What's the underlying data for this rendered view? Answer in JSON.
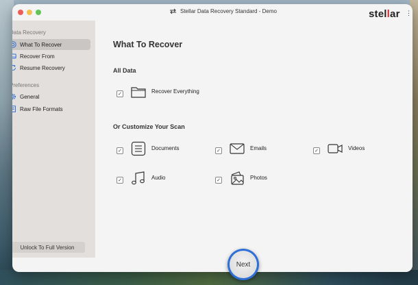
{
  "window": {
    "title": "Stellar Data Recovery Standard - Demo",
    "brand_part1": "stel",
    "brand_part2": "l",
    "brand_part3": "ar"
  },
  "sidebar": {
    "sections": [
      {
        "label": "Data Recovery"
      },
      {
        "label": "Preferences"
      }
    ],
    "items": [
      {
        "label": "What To Recover",
        "icon": "target-icon",
        "active": true
      },
      {
        "label": "Recover From",
        "icon": "drive-icon",
        "active": false
      },
      {
        "label": "Resume Recovery",
        "icon": "refresh-icon",
        "active": false
      },
      {
        "label": "General",
        "icon": "gear-icon",
        "active": false
      },
      {
        "label": "Raw File Formats",
        "icon": "file-list-icon",
        "active": false
      }
    ],
    "unlock_label": "Unlock To Full Version"
  },
  "main": {
    "title": "What To Recover",
    "all_data_label": "All Data",
    "customize_label": "Or Customize Your Scan",
    "options": [
      {
        "label": "Recover Everything",
        "icon": "folder-icon",
        "checked": true
      },
      {
        "label": "Documents",
        "icon": "document-icon",
        "checked": true
      },
      {
        "label": "Emails",
        "icon": "envelope-icon",
        "checked": true
      },
      {
        "label": "Videos",
        "icon": "video-camera-icon",
        "checked": true
      },
      {
        "label": "Audio",
        "icon": "music-note-icon",
        "checked": true
      },
      {
        "label": "Photos",
        "icon": "photos-icon",
        "checked": true
      }
    ],
    "check_glyph": "✓"
  },
  "footer": {
    "next_label": "Next"
  },
  "colors": {
    "accent": "#2f6fd8",
    "brand_red": "#d02a2a"
  }
}
